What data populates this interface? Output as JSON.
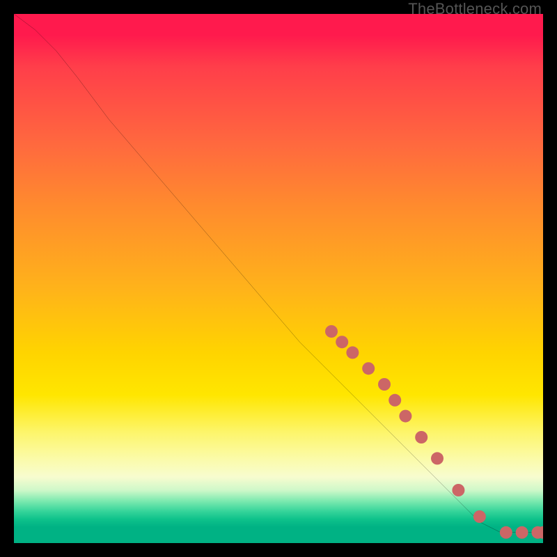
{
  "watermark": "TheBottleneck.com",
  "chart_data": {
    "type": "line",
    "title": "",
    "xlabel": "",
    "ylabel": "",
    "xlim": [
      0,
      100
    ],
    "ylim": [
      0,
      100
    ],
    "grid": false,
    "legend": false,
    "axes_visible": false,
    "gradient_background": {
      "top_color": "#ff1a4d",
      "bottom_color": "#00b284",
      "meaning": "red-to-green performance gradient"
    },
    "series": [
      {
        "name": "bottleneck-curve",
        "color": "#000000",
        "x": [
          0,
          4,
          8,
          12,
          18,
          24,
          30,
          36,
          42,
          48,
          54,
          60,
          66,
          72,
          78,
          84,
          88,
          92,
          96,
          100
        ],
        "y": [
          100,
          97,
          93,
          88,
          80,
          73,
          66,
          59,
          52,
          45,
          38,
          32,
          26,
          20,
          14,
          8,
          4,
          2,
          2,
          2
        ]
      }
    ],
    "markers": {
      "name": "highlighted-points",
      "color": "#cc6666",
      "radius": 9,
      "x": [
        60,
        62,
        64,
        67,
        70,
        72,
        74,
        77,
        80,
        84,
        88,
        93,
        96,
        99,
        100
      ],
      "y": [
        40,
        38,
        36,
        33,
        30,
        27,
        24,
        20,
        16,
        10,
        5,
        2,
        2,
        2,
        2
      ]
    }
  }
}
